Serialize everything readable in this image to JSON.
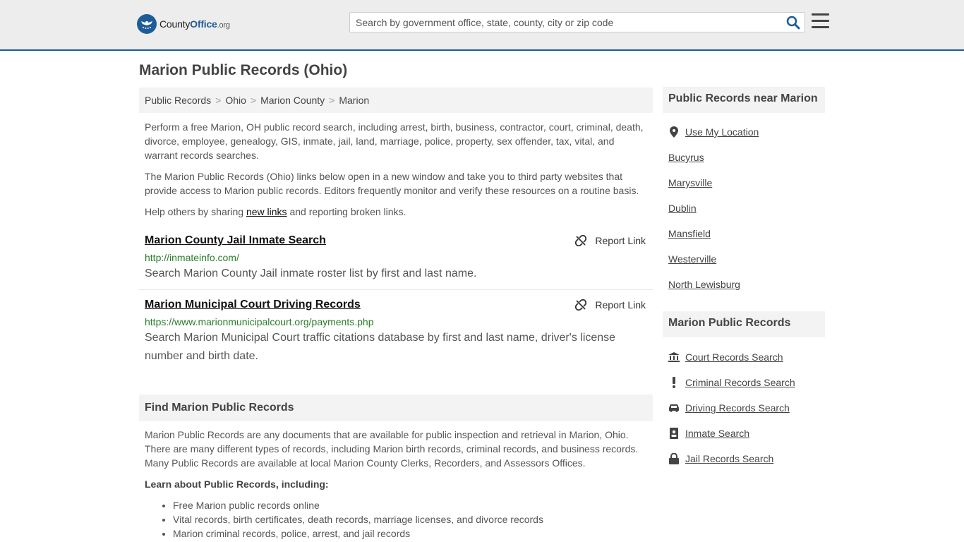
{
  "header": {
    "logo_name": "County",
    "logo_brand": "Office",
    "logo_tld": ".org",
    "search_placeholder": "Search by government office, state, county, city or zip code"
  },
  "page_title": "Marion Public Records (Ohio)",
  "breadcrumb": [
    "Public Records",
    "Ohio",
    "Marion County",
    "Marion"
  ],
  "intro": {
    "p1": "Perform a free Marion, OH public record search, including arrest, birth, business, contractor, court, criminal, death, divorce, employee, genealogy, GIS, inmate, jail, land, marriage, police, property, sex offender, tax, vital, and warrant records searches.",
    "p2": "The Marion Public Records (Ohio) links below open in a new window and take you to third party websites that provide access to Marion public records. Editors frequently monitor and verify these resources on a routine basis.",
    "p3_before": "Help others by sharing ",
    "p3_link": "new links",
    "p3_after": " and reporting broken links."
  },
  "report_label": "Report Link",
  "results": [
    {
      "title": "Marion County Jail Inmate Search",
      "url": "http://inmateinfo.com/",
      "desc": "Search Marion County Jail inmate roster list by first and last name."
    },
    {
      "title": "Marion Municipal Court Driving Records",
      "url": "https://www.marionmunicipalcourt.org/payments.php",
      "desc": "Search Marion Municipal Court traffic citations database by first and last name, driver's license number and birth date."
    }
  ],
  "find": {
    "heading": "Find Marion Public Records",
    "text": "Marion Public Records are any documents that are available for public inspection and retrieval in Marion, Ohio. There are many different types of records, including Marion birth records, criminal records, and business records. Many Public Records are available at local Marion County Clerks, Recorders, and Assessors Offices.",
    "learn_heading": "Learn about Public Records, including:",
    "learn_items": [
      "Free Marion public records online",
      "Vital records, birth certificates, death records, marriage licenses, and divorce records",
      "Marion criminal records, police, arrest, and jail records"
    ]
  },
  "sidebar": {
    "near_heading": "Public Records near Marion",
    "use_location": "Use My Location",
    "nearby": [
      "Bucyrus",
      "Marysville",
      "Dublin",
      "Mansfield",
      "Westerville",
      "North Lewisburg"
    ],
    "records_heading": "Marion Public Records",
    "records": [
      {
        "label": "Court Records Search",
        "icon": "courthouse-icon"
      },
      {
        "label": "Criminal Records Search",
        "icon": "exclamation-icon"
      },
      {
        "label": "Driving Records Search",
        "icon": "car-icon"
      },
      {
        "label": "Inmate Search",
        "icon": "id-badge-icon"
      },
      {
        "label": "Jail Records Search",
        "icon": "lock-icon"
      }
    ]
  },
  "colors": {
    "brand": "#1f5c97",
    "url_green": "#2a7d2a"
  }
}
